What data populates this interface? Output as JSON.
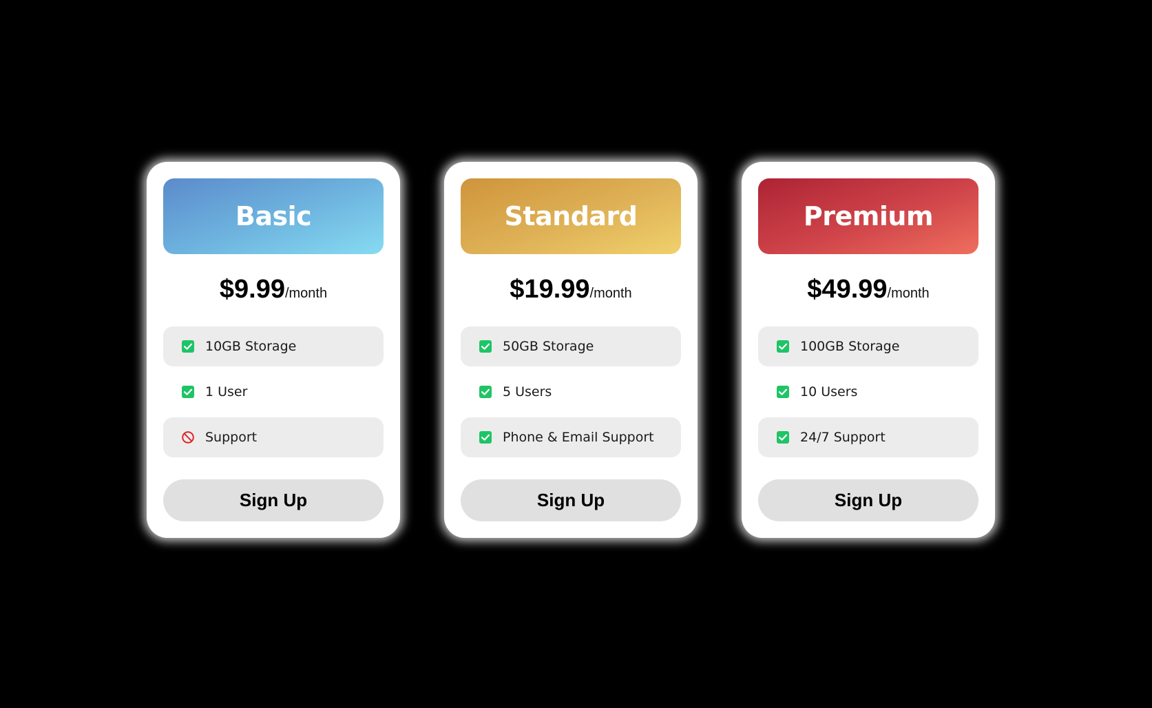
{
  "colors": {
    "page_background": "#000000",
    "card_background": "#ffffff",
    "check_green": "#1fc466",
    "no_red": "#e0252b",
    "row_shade": "#ececec",
    "button_background": "#e0e0e0"
  },
  "plans": [
    {
      "name": "Basic",
      "price": "$9.99",
      "period": "/month",
      "header_gradient": [
        "#5b8bcb",
        "#86dbf2"
      ],
      "features": [
        {
          "label": "10GB Storage",
          "icon": "check-icon"
        },
        {
          "label": "1 User",
          "icon": "check-icon"
        },
        {
          "label": "Support",
          "icon": "no-entry-icon"
        }
      ],
      "button_label": "Sign Up"
    },
    {
      "name": "Standard",
      "price": "$19.99",
      "period": "/month",
      "header_gradient": [
        "#cf943b",
        "#f0d16c"
      ],
      "features": [
        {
          "label": "50GB Storage",
          "icon": "check-icon"
        },
        {
          "label": "5 Users",
          "icon": "check-icon"
        },
        {
          "label": "Phone & Email Support",
          "icon": "check-icon"
        }
      ],
      "button_label": "Sign Up"
    },
    {
      "name": "Premium",
      "price": "$49.99",
      "period": "/month",
      "header_gradient": [
        "#ad2334",
        "#ef6f5e"
      ],
      "features": [
        {
          "label": "100GB Storage",
          "icon": "check-icon"
        },
        {
          "label": "10 Users",
          "icon": "check-icon"
        },
        {
          "label": "24/7 Support",
          "icon": "check-icon"
        }
      ],
      "button_label": "Sign Up"
    }
  ]
}
